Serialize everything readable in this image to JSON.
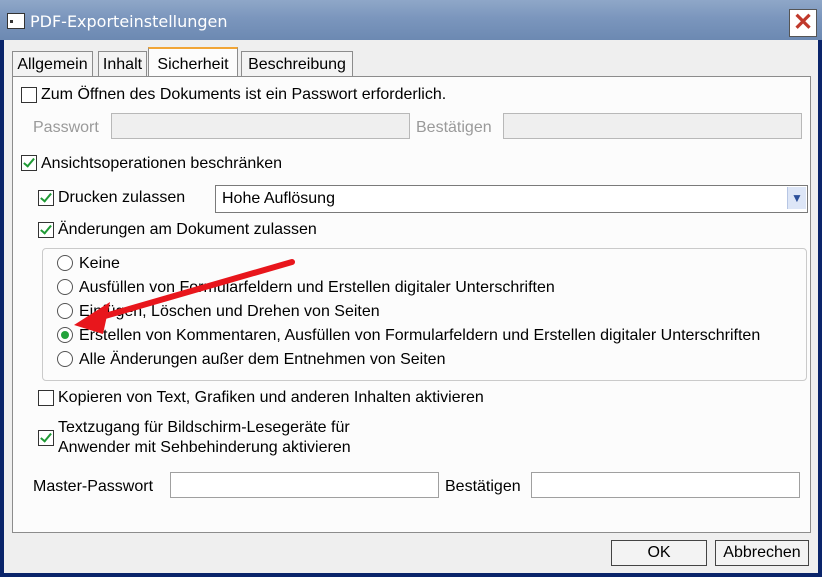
{
  "window": {
    "title": "PDF-Exporteinstellungen"
  },
  "tabs": [
    "Allgemein",
    "Inhalt",
    "Sicherheit",
    "Beschreibung"
  ],
  "security": {
    "open_password_required": {
      "label": "Zum Öffnen des Dokuments ist ein Passwort erforderlich.",
      "checked": false
    },
    "password_label": "Passwort",
    "password_confirm_label": "Bestätigen",
    "restrict_view_ops": {
      "label": "Ansichtsoperationen beschränken",
      "checked": true
    },
    "allow_print": {
      "label": "Drucken zulassen",
      "checked": true
    },
    "print_resolution": "Hohe Auflösung",
    "allow_changes": {
      "label": "Änderungen am Dokument zulassen",
      "checked": true
    },
    "change_options": [
      "Keine",
      "Ausfüllen von Formularfeldern und Erstellen digitaler Unterschriften",
      "Einfügen, Löschen und Drehen von Seiten",
      "Erstellen von Kommentaren, Ausfüllen von Formularfeldern und Erstellen digitaler Unterschriften",
      "Alle Änderungen außer dem Entnehmen von Seiten"
    ],
    "selected_change_option": "Erstellen von Kommentaren, Ausfüllen von Formularfeldern und Erstellen digitaler Unterschriften",
    "copy_content": {
      "label": "Kopieren von Text, Grafiken und anderen Inhalten aktivieren",
      "checked": false
    },
    "screen_reader": {
      "label_line1": "Textzugang für Bildschirm-Lesegeräte für",
      "label_line2": "Anwender mit Sehbehinderung aktivieren",
      "checked": true
    },
    "master_password_label": "Master-Passwort",
    "master_confirm_label": "Bestätigen"
  },
  "buttons": {
    "ok": "OK",
    "cancel": "Abbrechen"
  },
  "colors": {
    "annotation_arrow": "#e8161c",
    "checkmark": "#1f9a35",
    "radio_dot": "#23a33b",
    "active_tab_accent": "#f1a536"
  },
  "icons": {
    "title": "pdf-export-window-icon",
    "close": "close-icon"
  }
}
